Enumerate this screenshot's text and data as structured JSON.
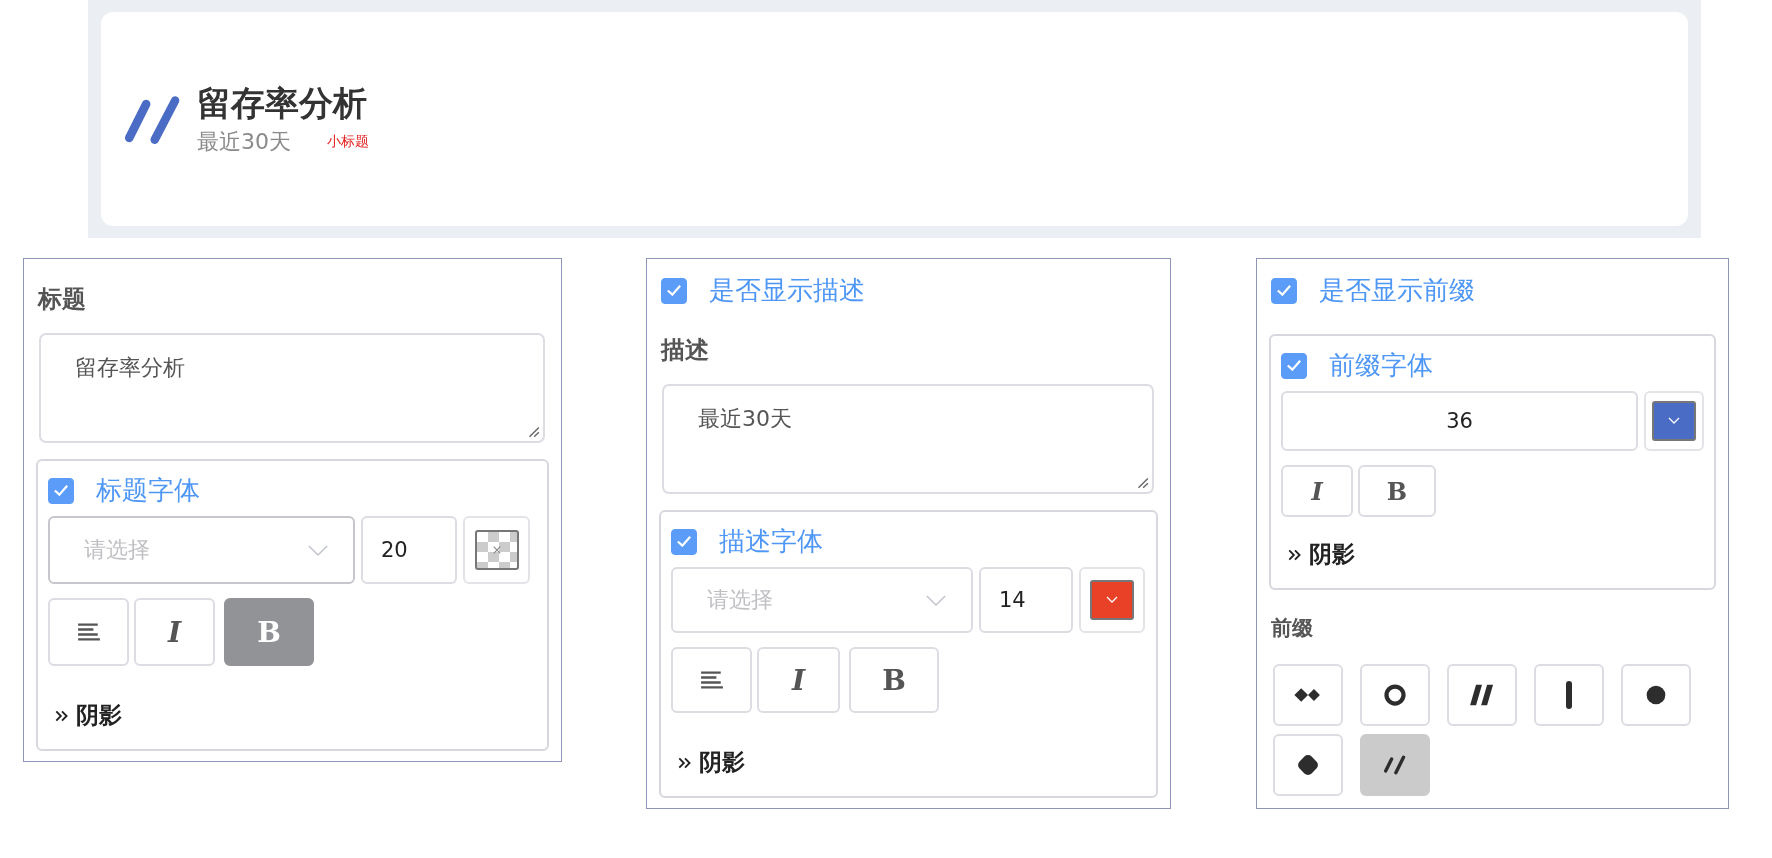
{
  "preview": {
    "title": "留存率分析",
    "subtitle": "最近30天",
    "tag": "小标题"
  },
  "panels": [
    {
      "label": "标题",
      "text_value": "留存率分析",
      "font": {
        "checkbox": {
          "label": "标题字体",
          "checked": true
        },
        "select_placeholder": "请选择",
        "size": "20",
        "swatch": {
          "kind": "empty"
        },
        "buttons": [
          {
            "kind": "align",
            "selected": false
          },
          {
            "kind": "italic",
            "label": "I",
            "selected": false
          },
          {
            "kind": "bold",
            "label": "B",
            "selected": true
          }
        ],
        "shadow": "阴影"
      }
    },
    {
      "show_toggle": {
        "label": "是否显示描述",
        "checked": true
      },
      "label": "描述",
      "text_value": "最近30天",
      "font": {
        "checkbox": {
          "label": "描述字体",
          "checked": true
        },
        "select_placeholder": "请选择",
        "size": "14",
        "swatch": {
          "kind": "solid",
          "color": "#e84127"
        },
        "buttons": [
          {
            "kind": "align",
            "selected": false
          },
          {
            "kind": "italic",
            "label": "I",
            "selected": false
          },
          {
            "kind": "bold",
            "label": "B",
            "selected": false
          }
        ],
        "shadow": "阴影"
      }
    },
    {
      "show_toggle": {
        "label": "是否显示前缀",
        "checked": true
      },
      "font": {
        "checkbox": {
          "label": "前缀字体",
          "checked": true
        },
        "size": "36",
        "swatch": {
          "kind": "solid",
          "color": "#4a6cc4"
        },
        "buttons": [
          {
            "kind": "italic",
            "label": "I",
            "selected": false
          },
          {
            "kind": "bold",
            "label": "B",
            "selected": false
          }
        ],
        "shadow": "阴影"
      },
      "prefix": {
        "label": "前缀",
        "options": [
          {
            "kind": "diamonds",
            "selected": false
          },
          {
            "kind": "ring",
            "selected": false
          },
          {
            "kind": "slashes-bold",
            "selected": false
          },
          {
            "kind": "bar",
            "selected": false
          },
          {
            "kind": "dot",
            "selected": false
          },
          {
            "kind": "rounded-square",
            "selected": false
          },
          {
            "kind": "slashes-thin",
            "selected": true
          }
        ]
      }
    }
  ]
}
